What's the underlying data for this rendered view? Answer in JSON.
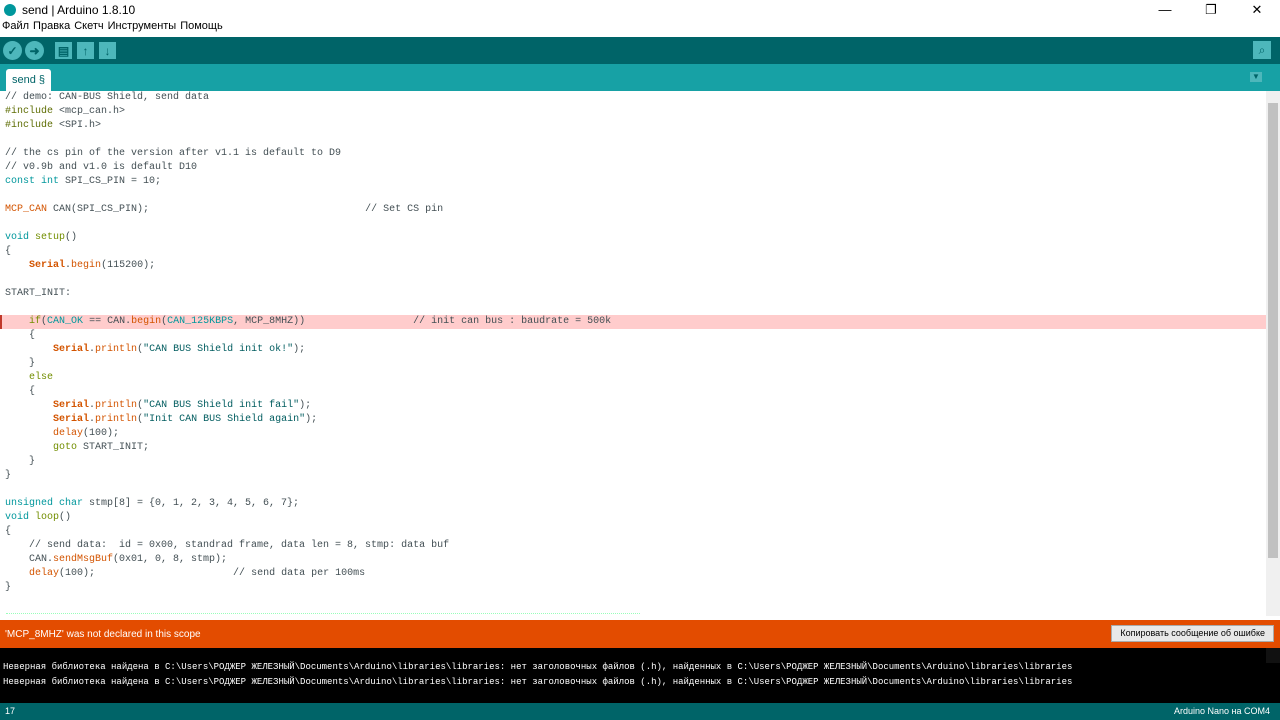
{
  "window": {
    "title": "send | Arduino 1.8.10",
    "minimize": "—",
    "maximize": "❐",
    "close": "✕"
  },
  "menu": [
    "Файл",
    "Правка",
    "Скетч",
    "Инструменты",
    "Помощь"
  ],
  "toolbar": {
    "verify": "✓",
    "upload": "➜",
    "new": "▤",
    "open": "↑",
    "save": "↓",
    "serial_monitor": "⌕"
  },
  "tab": {
    "label": "send §",
    "menu": "▼"
  },
  "code": [
    [
      [
        "// demo: CAN-BUS Shield, send data",
        "com"
      ]
    ],
    [
      [
        "#include ",
        "pp"
      ],
      [
        "<mcp_can.h>",
        "com"
      ]
    ],
    [
      [
        "#include ",
        "pp"
      ],
      [
        "<SPI.h>",
        "com"
      ]
    ],
    [],
    [
      [
        "// the cs pin of the version after v1.1 is default to D9",
        "com"
      ]
    ],
    [
      [
        "// v0.9b and v1.0 is default D10",
        "com"
      ]
    ],
    [
      [
        "const int",
        "type"
      ],
      [
        " SPI_CS_PIN = 10;",
        "com"
      ]
    ],
    [],
    [
      [
        "MCP_CAN",
        "fn"
      ],
      [
        " CAN(SPI_CS_PIN);                                    // Set CS pin",
        "com"
      ]
    ],
    [],
    [
      [
        "void",
        "type"
      ],
      [
        " ",
        "com"
      ],
      [
        "setup",
        "kw"
      ],
      [
        "()",
        "com"
      ]
    ],
    [
      [
        "{",
        "com"
      ]
    ],
    [
      [
        "    ",
        "com"
      ],
      [
        "Serial",
        "obj"
      ],
      [
        ".",
        "com"
      ],
      [
        "begin",
        "fn"
      ],
      [
        "(115200);",
        "com"
      ]
    ],
    [],
    [
      [
        "START_INIT:",
        "com"
      ]
    ],
    [],
    [
      [
        "    ",
        "com"
      ],
      [
        "if",
        "kw"
      ],
      [
        "(",
        "com"
      ],
      [
        "CAN_OK",
        "type"
      ],
      [
        " == CAN.",
        "com"
      ],
      [
        "begin",
        "fn"
      ],
      [
        "(",
        "com"
      ],
      [
        "CAN_125KBPS",
        "type"
      ],
      [
        ", MCP_8MHZ))                  // init can bus : baudrate = 500k",
        "com"
      ]
    ],
    [
      [
        "    {",
        "com"
      ]
    ],
    [
      [
        "        ",
        "com"
      ],
      [
        "Serial",
        "obj"
      ],
      [
        ".",
        "com"
      ],
      [
        "println",
        "fn"
      ],
      [
        "(",
        "com"
      ],
      [
        "\"CAN BUS Shield init ok!\"",
        "str"
      ],
      [
        ");",
        "com"
      ]
    ],
    [
      [
        "    }",
        "com"
      ]
    ],
    [
      [
        "    ",
        "com"
      ],
      [
        "else",
        "kw"
      ]
    ],
    [
      [
        "    {",
        "com"
      ]
    ],
    [
      [
        "        ",
        "com"
      ],
      [
        "Serial",
        "obj"
      ],
      [
        ".",
        "com"
      ],
      [
        "println",
        "fn"
      ],
      [
        "(",
        "com"
      ],
      [
        "\"CAN BUS Shield init fail\"",
        "str"
      ],
      [
        ");",
        "com"
      ]
    ],
    [
      [
        "        ",
        "com"
      ],
      [
        "Serial",
        "obj"
      ],
      [
        ".",
        "com"
      ],
      [
        "println",
        "fn"
      ],
      [
        "(",
        "com"
      ],
      [
        "\"Init CAN BUS Shield again\"",
        "str"
      ],
      [
        ");",
        "com"
      ]
    ],
    [
      [
        "        ",
        "com"
      ],
      [
        "delay",
        "fn"
      ],
      [
        "(100);",
        "com"
      ]
    ],
    [
      [
        "        ",
        "com"
      ],
      [
        "goto",
        "kw"
      ],
      [
        " START_INIT;",
        "com"
      ]
    ],
    [
      [
        "    }",
        "com"
      ]
    ],
    [
      [
        "}",
        "com"
      ]
    ],
    [],
    [
      [
        "unsigned char",
        "type"
      ],
      [
        " stmp[8] = {0, 1, 2, 3, 4, 5, 6, 7};",
        "com"
      ]
    ],
    [
      [
        "void",
        "type"
      ],
      [
        " ",
        "com"
      ],
      [
        "loop",
        "kw"
      ],
      [
        "()",
        "com"
      ]
    ],
    [
      [
        "{",
        "com"
      ]
    ],
    [
      [
        "    // send data:  id = 0x00, standrad frame, data len = 8, stmp: data buf",
        "com"
      ]
    ],
    [
      [
        "    CAN.",
        "com"
      ],
      [
        "sendMsgBuf",
        "fn"
      ],
      [
        "(0x01, 0, 8, stmp);",
        "com"
      ]
    ],
    [
      [
        "    ",
        "com"
      ],
      [
        "delay",
        "fn"
      ],
      [
        "(100);                       // send data per 100ms",
        "com"
      ]
    ],
    [
      [
        "}",
        "com"
      ]
    ]
  ],
  "error": {
    "message": "'MCP_8MHZ' was not declared in this scope",
    "copy_button": "Копировать сообщение об ошибке"
  },
  "console": [
    "Неверная библиотека найдена в C:\\Users\\РОДЖЕР ЖЕЛЕЗНЫЙ\\Documents\\Arduino\\libraries\\libraries: нет заголовочных файлов (.h), найденных в C:\\Users\\РОДЖЕР ЖЕЛЕЗНЫЙ\\Documents\\Arduino\\libraries\\libraries",
    "Неверная библиотека найдена в C:\\Users\\РОДЖЕР ЖЕЛЕЗНЫЙ\\Documents\\Arduino\\libraries\\libraries: нет заголовочных файлов (.h), найденных в C:\\Users\\РОДЖЕР ЖЕЛЕЗНЫЙ\\Documents\\Arduino\\libraries\\libraries"
  ],
  "status": {
    "line": "17",
    "board": "Arduino Nano на COM4"
  }
}
